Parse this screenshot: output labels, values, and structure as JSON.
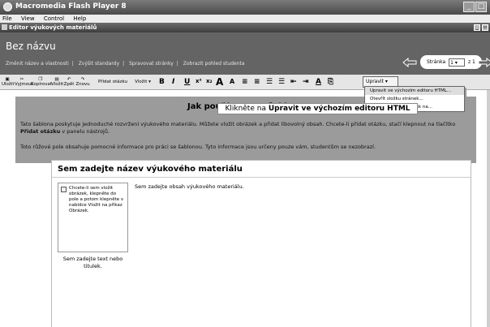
{
  "window": {
    "title": "Macromedia Flash Player 8"
  },
  "menu": [
    "File",
    "View",
    "Control",
    "Help"
  ],
  "doc": {
    "title": "Editor výukových materiálů"
  },
  "header": {
    "page_title": "Bez názvu",
    "links": [
      "Změnit název a vlastnosti",
      "Zvýšit standardy",
      "Spravovat stránky",
      "Zobrazit pohled studenta"
    ],
    "page_label": "Stránka",
    "page_value": "1",
    "page_total": "z 1"
  },
  "toolbar": {
    "buttons": [
      "Uložit",
      "Vyjmout",
      "Kopírovat",
      "Vložit",
      "Zpět",
      "Znovu",
      "Přidat otázku",
      "Vložit ▾"
    ],
    "format": [
      "B",
      "I",
      "U",
      "x²",
      "x₂",
      "A",
      "A",
      "≡",
      "≡",
      "☰",
      "☰",
      "⇤",
      "⇥",
      "A"
    ],
    "upravit_label": "Upravit ▾"
  },
  "dropdown": {
    "items": [
      "Upravit ve výchozím editoru HTML...",
      "Otevřít složku stránek...",
      "Upravit soubor stránek na..."
    ]
  },
  "tooltip": {
    "prefix": "Klikněte na ",
    "bold": "Upravit ve výchozím editoru HTML"
  },
  "info": {
    "title": "Jak používat tuto šablonu",
    "p1": "Tato šablona poskytuje jednoduché rozvržení výukového materiálu. Můžete vložit obrázek a přidat libovolný obsah. Chcete-li přidat otázku, stačí klepnout na tlačítko",
    "p1b": "Přidat otázku",
    "p1c": " v panelu nástrojů.",
    "p2": "Toto růžové pole obsahuje pomocné informace pro práci se šablonou. Tyto informace jsou určeny pouze vám, studentům se nezobrazí."
  },
  "content": {
    "title": "Sem zadejte název výukového materiálu",
    "image_hint": "Chcete-li sem vložit obrázek, klepněte do pole a potom klepněte v nabídce Vložit na příkaz Obrázek.",
    "side_text": "Sem zadejte text nebo titulek.",
    "body": "Sem zadejte obsah výukového materiálu."
  }
}
